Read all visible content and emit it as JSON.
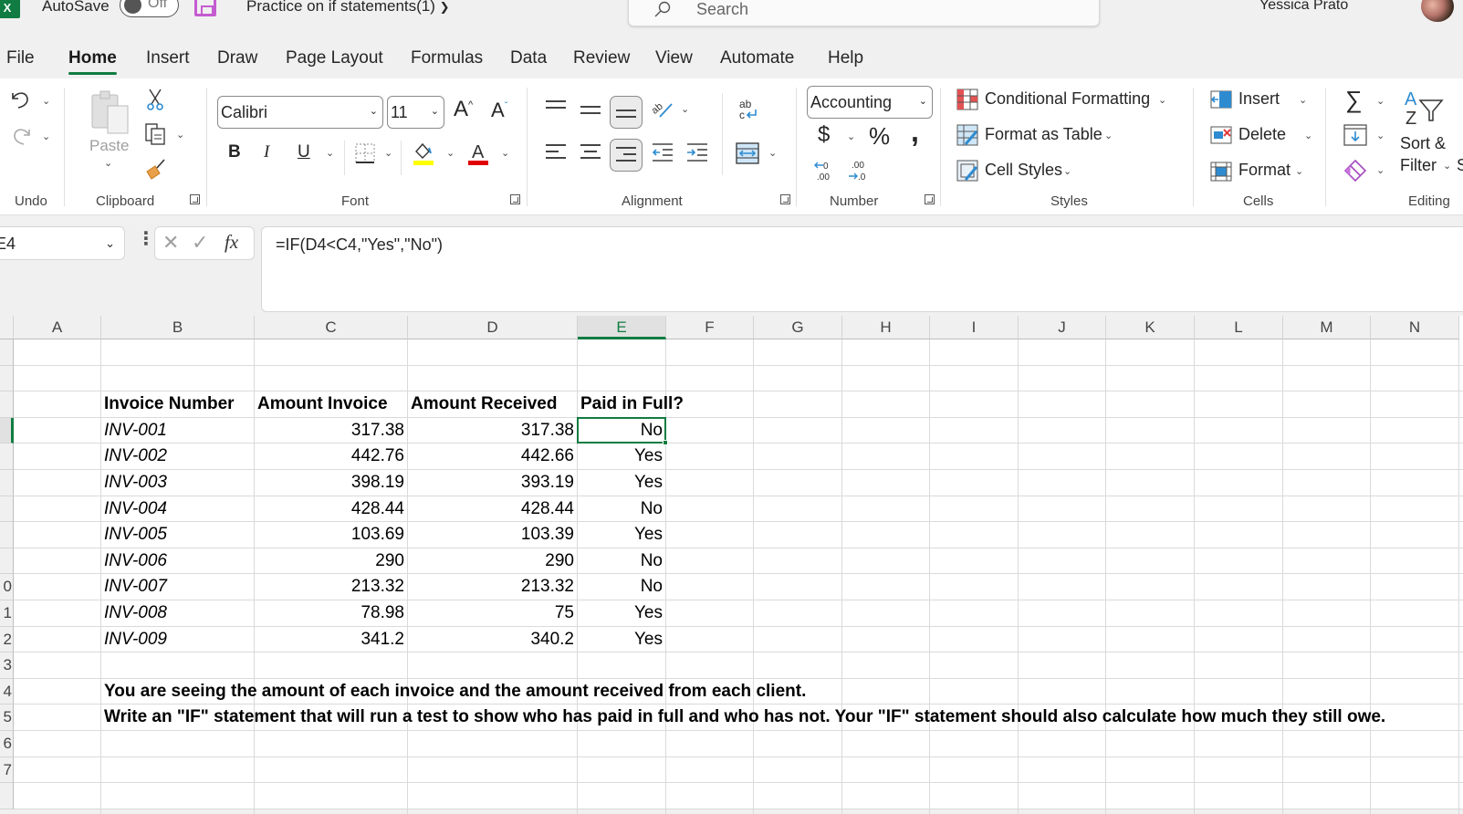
{
  "titlebar": {
    "app_logo": "X",
    "autosave_label": "AutoSave",
    "autosave_state": "Off",
    "document_title": "Practice on if statements(1)",
    "search_placeholder": "Search",
    "user_name": "Yessica Prato"
  },
  "tabs": [
    {
      "label": "File"
    },
    {
      "label": "Home",
      "active": true
    },
    {
      "label": "Insert"
    },
    {
      "label": "Draw"
    },
    {
      "label": "Page Layout"
    },
    {
      "label": "Formulas"
    },
    {
      "label": "Data"
    },
    {
      "label": "Review"
    },
    {
      "label": "View"
    },
    {
      "label": "Automate"
    },
    {
      "label": "Help"
    }
  ],
  "ribbon": {
    "undo": {
      "group_label": "Undo"
    },
    "clipboard": {
      "paste_label": "Paste",
      "group_label": "Clipboard"
    },
    "font": {
      "font_name": "Calibri",
      "font_size": "11",
      "bold": "B",
      "italic": "I",
      "underline": "U",
      "group_label": "Font",
      "fill_color": "#ffff00",
      "font_color": "#e00000"
    },
    "alignment": {
      "group_label": "Alignment"
    },
    "number": {
      "format": "Accounting",
      "currency": "$",
      "percent": "%",
      "comma": ",",
      "increase_decimal": "←.0 .00",
      "decrease_decimal": ".00 →.0",
      "group_label": "Number"
    },
    "styles": {
      "conditional_formatting": "Conditional Formatting",
      "format_as_table": "Format as Table",
      "cell_styles": "Cell Styles",
      "group_label": "Styles"
    },
    "cells": {
      "insert": "Insert",
      "delete": "Delete",
      "format": "Format",
      "group_label": "Cells"
    },
    "editing": {
      "sum": "∑",
      "sort_filter_line1": "Sort &",
      "sort_filter_line2": "Filter",
      "group_label": "Editing",
      "partial": "S"
    }
  },
  "formula_bar": {
    "name_box": "E4",
    "formula": "=IF(D4<C4,\"Yes\",\"No\")"
  },
  "sheet": {
    "columns": [
      "A",
      "B",
      "C",
      "D",
      "E",
      "F",
      "G",
      "H",
      "I",
      "J",
      "K",
      "L",
      "M",
      "N"
    ],
    "selected_column": "E",
    "row_numbers": [
      "",
      "",
      "",
      "",
      "",
      "",
      "",
      "",
      "",
      "0",
      "1",
      "2",
      "3",
      "4",
      "5",
      "6",
      "7"
    ],
    "headers": [
      "Invoice Number",
      "Amount Invoice",
      "Amount Received",
      "Paid in Full?"
    ],
    "rows": [
      {
        "invoice": "INV-001",
        "amount_invoice": "317.38",
        "amount_received": "317.38",
        "paid": "No"
      },
      {
        "invoice": "INV-002",
        "amount_invoice": "442.76",
        "amount_received": "442.66",
        "paid": "Yes"
      },
      {
        "invoice": "INV-003",
        "amount_invoice": "398.19",
        "amount_received": "393.19",
        "paid": "Yes"
      },
      {
        "invoice": "INV-004",
        "amount_invoice": "428.44",
        "amount_received": "428.44",
        "paid": "No"
      },
      {
        "invoice": "INV-005",
        "amount_invoice": "103.69",
        "amount_received": "103.39",
        "paid": "Yes"
      },
      {
        "invoice": "INV-006",
        "amount_invoice": "290",
        "amount_received": "290",
        "paid": "No"
      },
      {
        "invoice": "INV-007",
        "amount_invoice": "213.32",
        "amount_received": "213.32",
        "paid": "No"
      },
      {
        "invoice": "INV-008",
        "amount_invoice": "78.98",
        "amount_received": "75",
        "paid": "Yes"
      },
      {
        "invoice": "INV-009",
        "amount_invoice": "341.2",
        "amount_received": "340.2",
        "paid": "Yes"
      }
    ],
    "instructions": [
      "You are seeing the amount of each invoice and the amount received from each client.",
      "Write an \"IF\" statement that will run a test to show who has paid in full and who has not. Your \"IF\" statement should also calculate how much they still owe."
    ]
  }
}
